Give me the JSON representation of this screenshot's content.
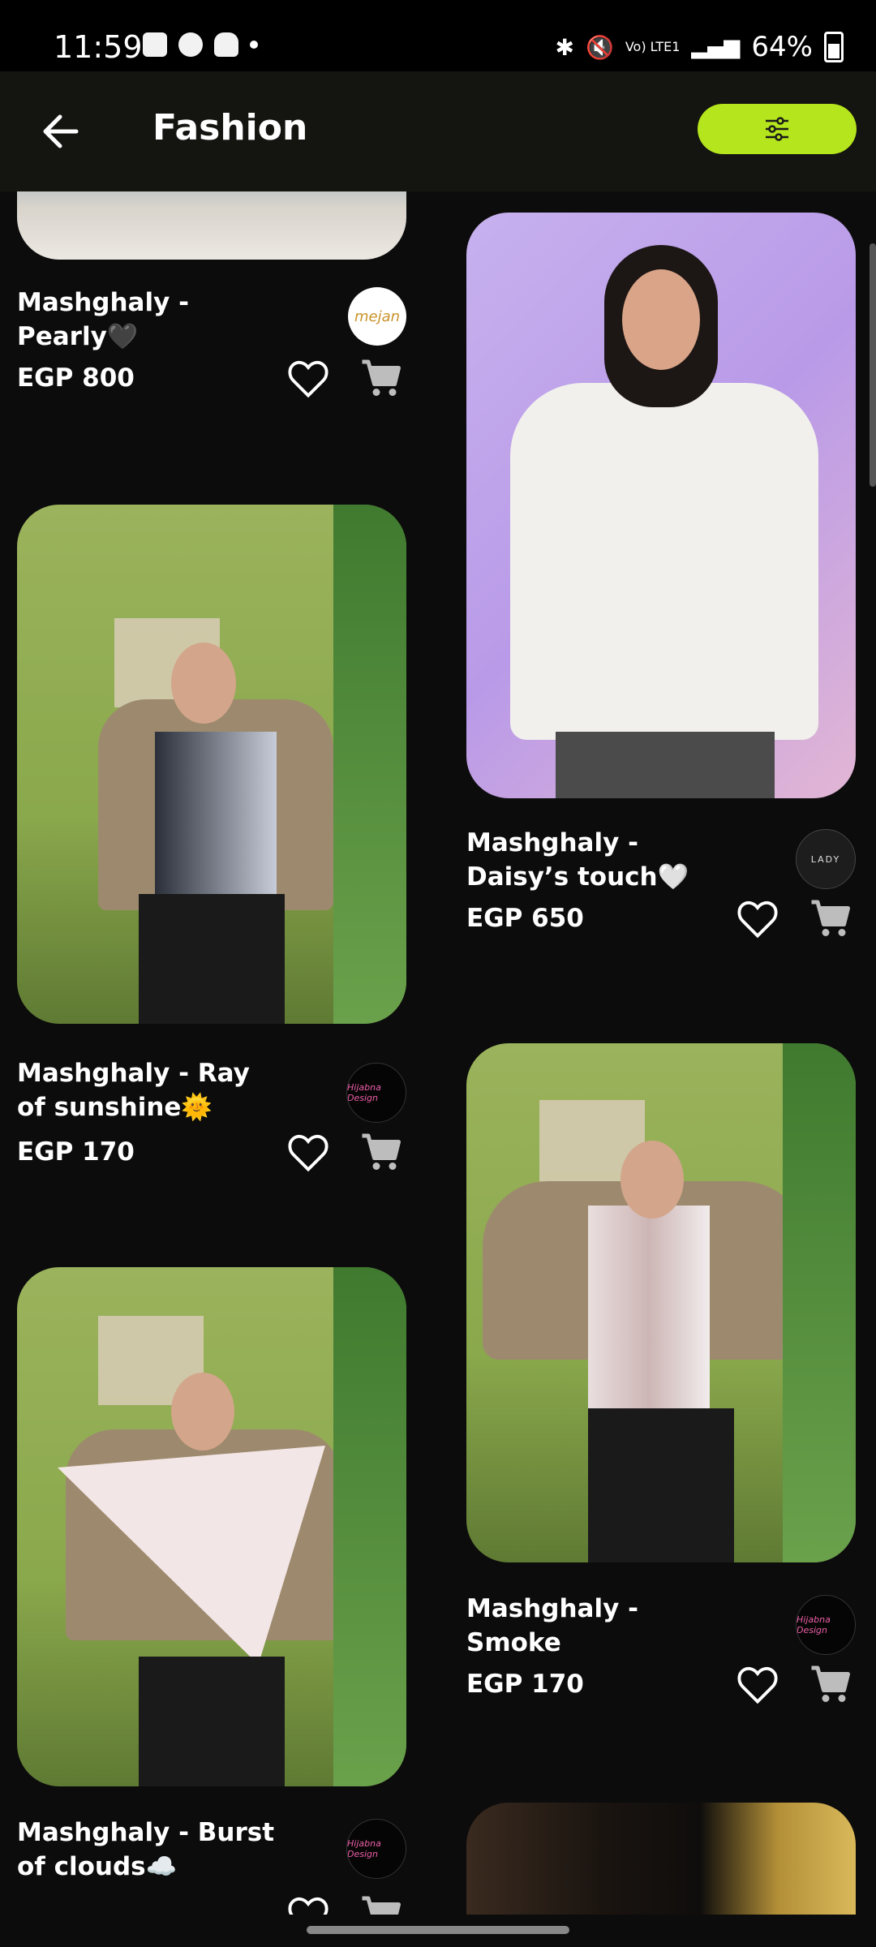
{
  "status_bar": {
    "time": "11:59",
    "battery": "64%",
    "network": "Vo) LTE1"
  },
  "header": {
    "title": "Fashion"
  },
  "products": [
    {
      "name": "Mashghaly - Pearly🖤",
      "price": "EGP 800",
      "brand_logo": "mejan"
    },
    {
      "name": "Mashghaly - Daisy’s touch🤍",
      "price": "EGP 650",
      "brand_logo": "LADY"
    },
    {
      "name": "Mashghaly - Ray of sunshine🌞",
      "price": "EGP 170",
      "brand_logo": "Hijabna Design"
    },
    {
      "name": "Mashghaly - Smoke",
      "price": "EGP 170",
      "brand_logo": "Hijabna Design"
    },
    {
      "name": "Mashghaly - Burst of clouds☁️",
      "price": "",
      "brand_logo": "Hijabna Design"
    }
  ],
  "colors": {
    "accent": "#b5e51d",
    "background": "#0c0c0c"
  }
}
